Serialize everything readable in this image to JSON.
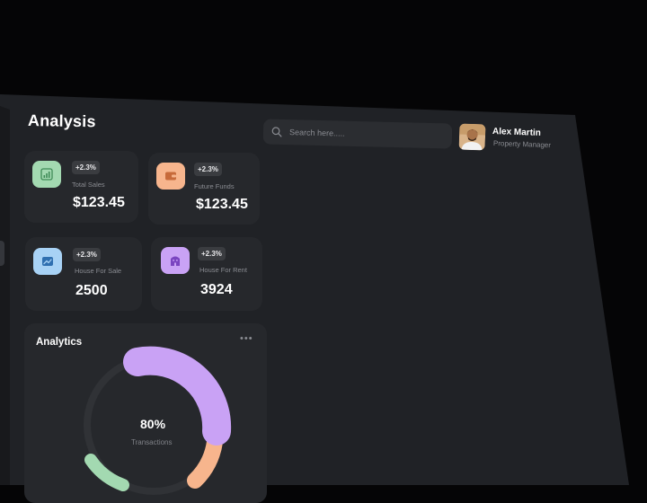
{
  "header": {
    "title": "Analysis",
    "search": {
      "placeholder": "Search here....."
    },
    "user": {
      "name": "Alex Martin",
      "role": "Property Manager"
    }
  },
  "stats": [
    {
      "label": "Total Sales",
      "value": "$123.45",
      "change": "+2.3%",
      "icon": "bar-chart-icon",
      "color": "#a3d9b1"
    },
    {
      "label": "Future Funds",
      "value": "$123.45",
      "change": "+2.3%",
      "icon": "wallet-icon",
      "color": "#f7b58d"
    },
    {
      "label": "House For Sale",
      "value": "2500",
      "change": "+2.3%",
      "icon": "trend-up-icon",
      "color": "#a8d2f5"
    },
    {
      "label": "House For Rent",
      "value": "3924",
      "change": "+2.3%",
      "icon": "building-icon",
      "color": "#c9a2f5"
    }
  ],
  "analytics": {
    "title": "Analytics",
    "more_icon": "•••",
    "donut": {
      "value": "80%",
      "label": "Transactions",
      "percent": 80
    },
    "colors": {
      "primary": "#c9a2f5",
      "secondary": "#f7b58d",
      "tertiary": "#a3d9b1",
      "track": "#3a3c40"
    }
  }
}
